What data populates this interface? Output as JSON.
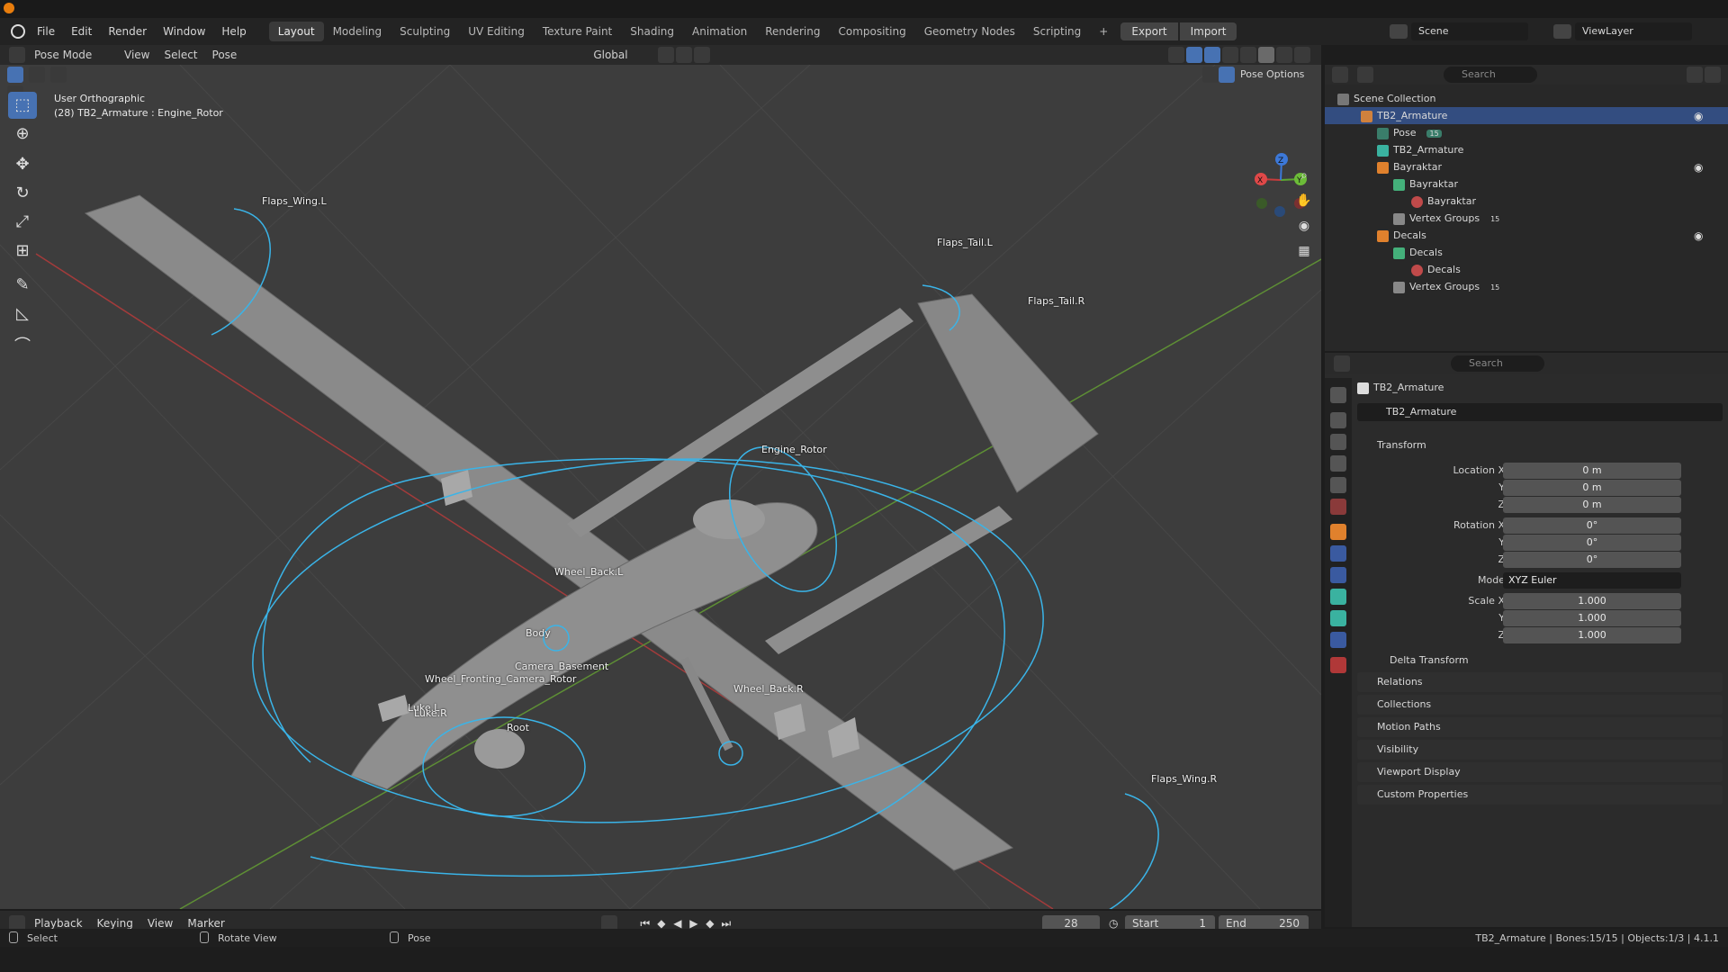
{
  "menus": [
    "File",
    "Edit",
    "Render",
    "Window",
    "Help"
  ],
  "workspaces": [
    "Layout",
    "Modeling",
    "Sculpting",
    "UV Editing",
    "Texture Paint",
    "Shading",
    "Animation",
    "Rendering",
    "Compositing",
    "Geometry Nodes",
    "Scripting"
  ],
  "add_tab": "+",
  "export_label": "Export",
  "import_label": "Import",
  "scene_name": "Scene",
  "viewlayer_name": "ViewLayer",
  "viewport": {
    "mode": "Pose Mode",
    "menus": [
      "View",
      "Select",
      "Pose"
    ],
    "orientation": "Global",
    "pose_options": "Pose Options",
    "info_line1": "User Orthographic",
    "info_line2": "(28) TB2_Armature : Engine_Rotor",
    "axis_labels": {
      "x": "X",
      "y": "Y",
      "z": "Z"
    }
  },
  "bones": [
    {
      "label": "Flaps_Wing.L"
    },
    {
      "label": "Flaps_Tail.L"
    },
    {
      "label": "Flaps_Tail.R"
    },
    {
      "label": "Engine_Rotor"
    },
    {
      "label": "Wheel_Back.L"
    },
    {
      "label": "Body"
    },
    {
      "label": "Camera_Basement"
    },
    {
      "label": "Wheel_Fronting_Camera_Rotor"
    },
    {
      "label": "Luke.L"
    },
    {
      "label": "Luke.R"
    },
    {
      "label": "Root"
    },
    {
      "label": "Wheel_Back.R"
    },
    {
      "label": "Flaps_Wing.R"
    }
  ],
  "outliner": {
    "search_placeholder": "Search",
    "root": "Scene Collection",
    "items": [
      {
        "label": "TB2_Armature",
        "selected": true
      },
      {
        "label": "Pose"
      },
      {
        "label": "TB2_Armature"
      },
      {
        "label": "Bayraktar"
      },
      {
        "label": "Bayraktar"
      },
      {
        "label": "Bayraktar"
      },
      {
        "label": "Vertex Groups"
      },
      {
        "label": "Decals"
      },
      {
        "label": "Decals"
      },
      {
        "label": "Decals"
      },
      {
        "label": "Vertex Groups"
      }
    ],
    "pose_badge": "15",
    "vg_badge_1": "15",
    "vg_badge_2": "15"
  },
  "properties": {
    "search_placeholder": "Search",
    "object_name": "TB2_Armature",
    "data_name": "TB2_Armature",
    "transform_header": "Transform",
    "location_label": "Location X",
    "rotation_label": "Rotation X",
    "scale_label": "Scale X",
    "y_label": "Y",
    "z_label": "Z",
    "mode_label": "Mode",
    "location": [
      "0 m",
      "0 m",
      "0 m"
    ],
    "rotation": [
      "0°",
      "0°",
      "0°"
    ],
    "mode": "XYZ Euler",
    "scale": [
      "1.000",
      "1.000",
      "1.000"
    ],
    "panels": [
      "Delta Transform",
      "Relations",
      "Collections",
      "Motion Paths",
      "Visibility",
      "Viewport Display",
      "Custom Properties"
    ]
  },
  "timeline": {
    "menus": [
      "Playback",
      "Keying",
      "View",
      "Marker"
    ],
    "current_frame": "28",
    "start_label": "Start",
    "start": "1",
    "end_label": "End",
    "end": "250"
  },
  "status": {
    "select": "Select",
    "rotate": "Rotate View",
    "pose": "Pose",
    "info": "TB2_Armature | Bones:15/15 | Objects:1/3 | 4.1.1"
  },
  "colors": {
    "accent": "#4772b3",
    "bone": "#3ab4e8",
    "viewport_bg": "#3d3d3d",
    "x_axis": "#c83c3c",
    "y_axis": "#5ea832"
  }
}
